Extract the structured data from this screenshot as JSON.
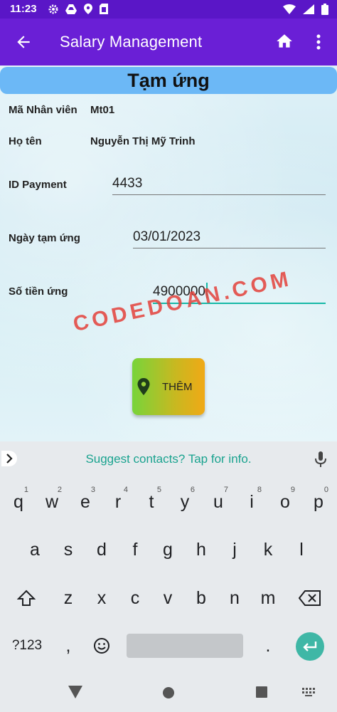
{
  "status_bar": {
    "time": "11:23"
  },
  "app_bar": {
    "title": "Salary Management"
  },
  "page": {
    "banner": "Tạm ứng",
    "employee_id_label": "Mã Nhân viên",
    "employee_id_value": "Mt01",
    "name_label": "Họ tên",
    "name_value": "Nguyễn Thị Mỹ Trinh",
    "payment_id_label": "ID Payment",
    "payment_id_value": "4433",
    "advance_date_label": "Ngày tạm ứng",
    "advance_date_value": "03/01/2023",
    "amount_label": "Số tiền ứng",
    "amount_value": "4900000",
    "watermark": "CODEDOAN.COM",
    "add_button": "THÊM"
  },
  "keyboard": {
    "suggestion": "Suggest contacts? Tap for info.",
    "row1": [
      "q",
      "w",
      "e",
      "r",
      "t",
      "y",
      "u",
      "i",
      "o",
      "p"
    ],
    "row1_hints": [
      "1",
      "2",
      "3",
      "4",
      "5",
      "6",
      "7",
      "8",
      "9",
      "0"
    ],
    "row2": [
      "a",
      "s",
      "d",
      "f",
      "g",
      "h",
      "j",
      "k",
      "l"
    ],
    "row3": [
      "z",
      "x",
      "c",
      "v",
      "b",
      "n",
      "m"
    ],
    "symbols_key": "?123",
    "comma_key": ",",
    "period_key": "."
  },
  "colors": {
    "status_bar": "#5a16c7",
    "app_bar": "#6a1fd6",
    "banner": "#6cb8f6",
    "accent": "#16b8a6"
  }
}
